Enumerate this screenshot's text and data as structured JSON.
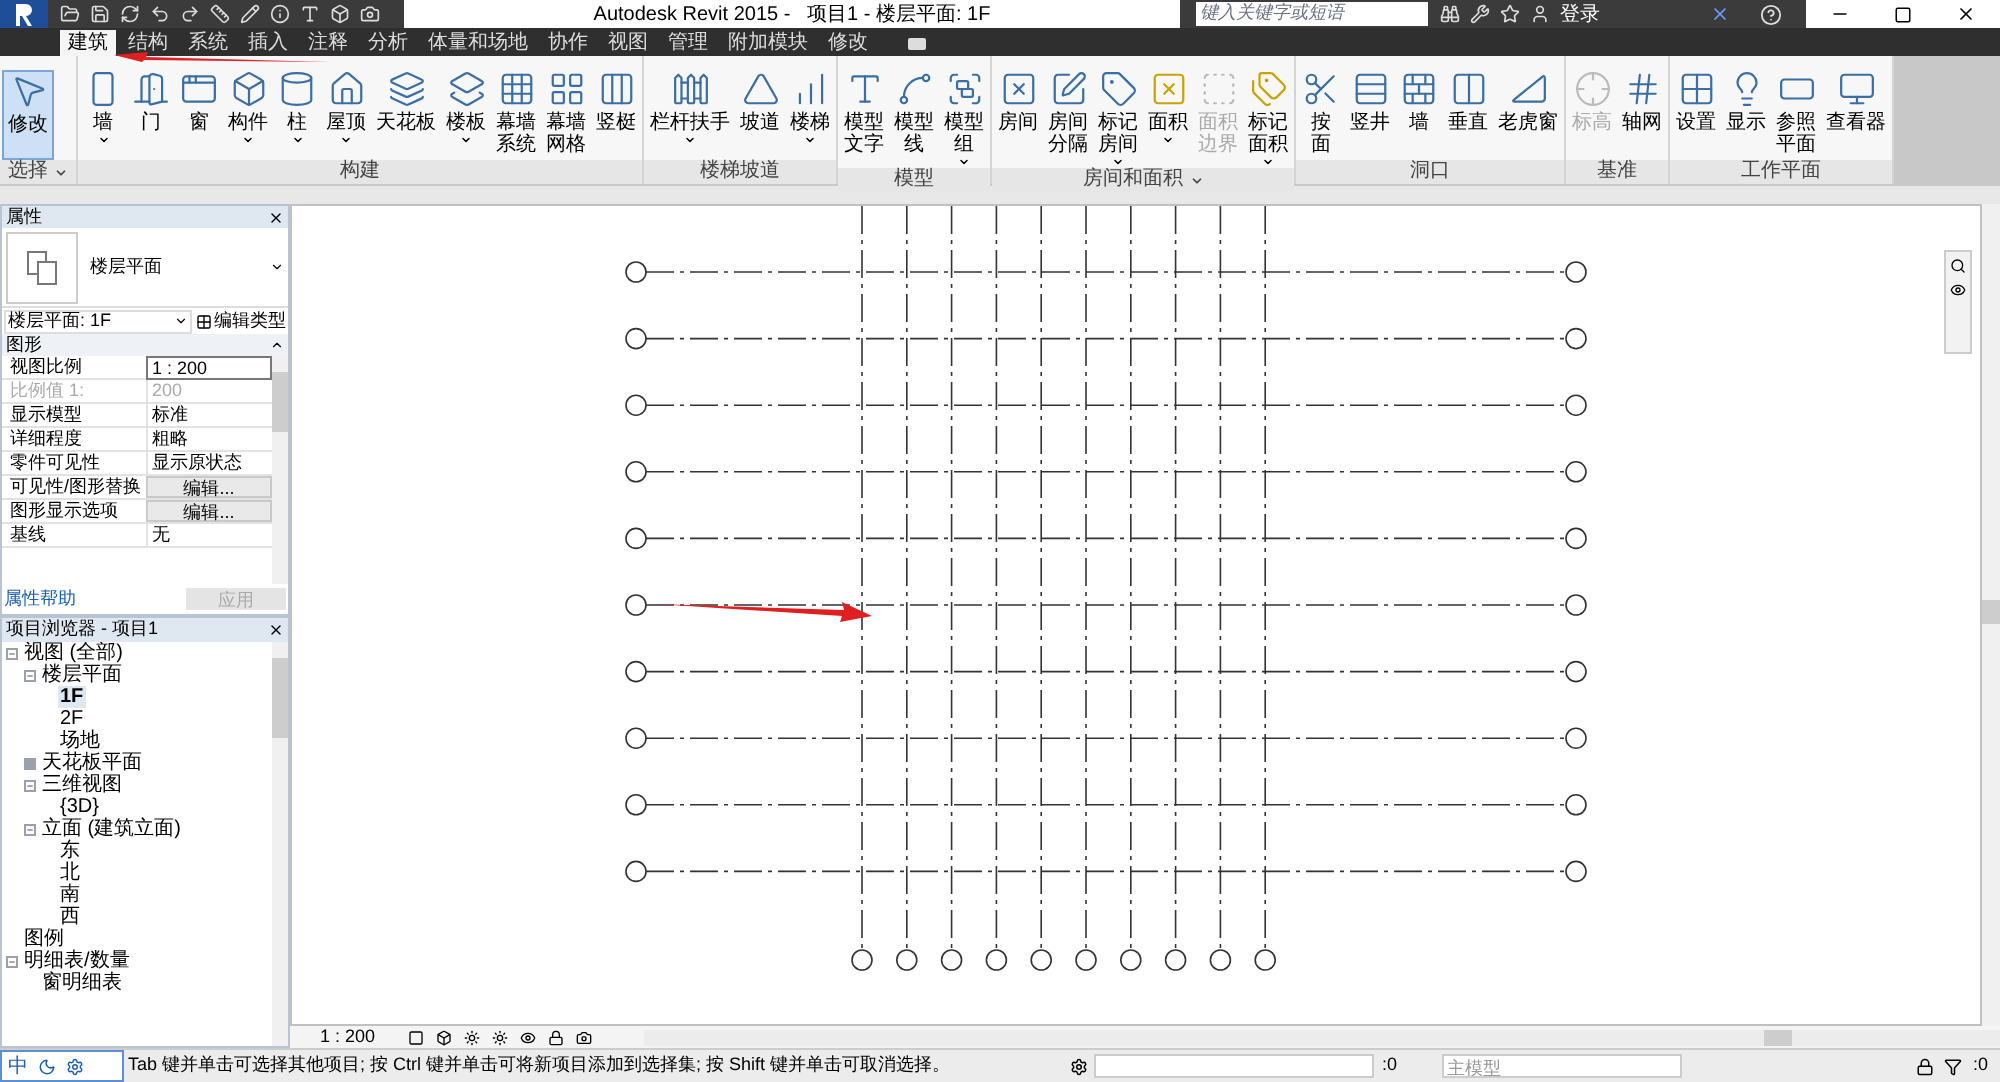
{
  "window": {
    "title": "Autodesk Revit 2015 -   项目1 - 楼层平面: 1F",
    "search": {
      "placeholder": "键入关键字或短语"
    },
    "login": "登录"
  },
  "tabs": [
    {
      "label": "建筑",
      "selected": true
    },
    {
      "label": "结构",
      "selected": false
    },
    {
      "label": "系统",
      "selected": false
    },
    {
      "label": "插入",
      "selected": false
    },
    {
      "label": "注释",
      "selected": false
    },
    {
      "label": "分析",
      "selected": false
    },
    {
      "label": "体量和场地",
      "selected": false
    },
    {
      "label": "协作",
      "selected": false
    },
    {
      "label": "视图",
      "selected": false
    },
    {
      "label": "管理",
      "selected": false
    },
    {
      "label": "附加模块",
      "selected": false
    },
    {
      "label": "修改",
      "selected": false
    }
  ],
  "ribbon": [
    {
      "label": "选择",
      "has_menu": true,
      "tools": [
        {
          "lines": [
            "修改"
          ],
          "selected": true,
          "disabled": false,
          "has_menu": false
        }
      ]
    },
    {
      "label": "构建",
      "has_menu": false,
      "tools": [
        {
          "lines": [
            "墙"
          ],
          "selected": false,
          "disabled": false,
          "has_menu": true
        },
        {
          "lines": [
            "门"
          ],
          "selected": false,
          "disabled": false,
          "has_menu": false
        },
        {
          "lines": [
            "窗"
          ],
          "selected": false,
          "disabled": false,
          "has_menu": false
        },
        {
          "lines": [
            "构件"
          ],
          "selected": false,
          "disabled": false,
          "has_menu": true
        },
        {
          "lines": [
            "柱"
          ],
          "selected": false,
          "disabled": false,
          "has_menu": true
        },
        {
          "lines": [
            "屋顶"
          ],
          "selected": false,
          "disabled": false,
          "has_menu": true
        },
        {
          "lines": [
            "天花板"
          ],
          "selected": false,
          "disabled": false,
          "has_menu": false
        },
        {
          "lines": [
            "楼板"
          ],
          "selected": false,
          "disabled": false,
          "has_menu": true
        },
        {
          "lines": [
            "幕墙",
            "系统"
          ],
          "selected": false,
          "disabled": false,
          "has_menu": false
        },
        {
          "lines": [
            "幕墙",
            "网格"
          ],
          "selected": false,
          "disabled": false,
          "has_menu": false
        },
        {
          "lines": [
            "竖梃"
          ],
          "selected": false,
          "disabled": false,
          "has_menu": false
        }
      ]
    },
    {
      "label": "楼梯坡道",
      "has_menu": false,
      "tools": [
        {
          "lines": [
            "栏杆扶手"
          ],
          "selected": false,
          "disabled": false,
          "has_menu": true
        },
        {
          "lines": [
            "坡道"
          ],
          "selected": false,
          "disabled": false,
          "has_menu": false
        },
        {
          "lines": [
            "楼梯"
          ],
          "selected": false,
          "disabled": false,
          "has_menu": true
        }
      ]
    },
    {
      "label": "模型",
      "has_menu": false,
      "tools": [
        {
          "lines": [
            "模型",
            "文字"
          ],
          "selected": false,
          "disabled": false,
          "has_menu": false
        },
        {
          "lines": [
            "模型",
            "线"
          ],
          "selected": false,
          "disabled": false,
          "has_menu": false
        },
        {
          "lines": [
            "模型",
            "组"
          ],
          "selected": false,
          "disabled": false,
          "has_menu": true
        }
      ]
    },
    {
      "label": "房间和面积",
      "has_menu": true,
      "tools": [
        {
          "lines": [
            "房间"
          ],
          "selected": false,
          "disabled": false,
          "has_menu": false
        },
        {
          "lines": [
            "房间",
            "分隔"
          ],
          "selected": false,
          "disabled": false,
          "has_menu": false
        },
        {
          "lines": [
            "标记",
            "房间"
          ],
          "selected": false,
          "disabled": false,
          "has_menu": true
        },
        {
          "lines": [
            "面积"
          ],
          "selected": false,
          "disabled": false,
          "has_menu": true
        },
        {
          "lines": [
            "面积",
            "边界"
          ],
          "selected": false,
          "disabled": true,
          "has_menu": false
        },
        {
          "lines": [
            "标记",
            "面积"
          ],
          "selected": false,
          "disabled": false,
          "has_menu": true
        }
      ]
    },
    {
      "label": "洞口",
      "has_menu": false,
      "tools": [
        {
          "lines": [
            "按",
            "面"
          ],
          "selected": false,
          "disabled": false,
          "has_menu": false
        },
        {
          "lines": [
            "竖井"
          ],
          "selected": false,
          "disabled": false,
          "has_menu": false
        },
        {
          "lines": [
            "墙"
          ],
          "selected": false,
          "disabled": false,
          "has_menu": false
        },
        {
          "lines": [
            "垂直"
          ],
          "selected": false,
          "disabled": false,
          "has_menu": false
        },
        {
          "lines": [
            "老虎窗"
          ],
          "selected": false,
          "disabled": false,
          "has_menu": false
        }
      ]
    },
    {
      "label": "基准",
      "has_menu": false,
      "tools": [
        {
          "lines": [
            "标高"
          ],
          "selected": false,
          "disabled": true,
          "has_menu": false
        },
        {
          "lines": [
            "轴网"
          ],
          "selected": false,
          "disabled": false,
          "has_menu": false
        }
      ]
    },
    {
      "label": "工作平面",
      "has_menu": false,
      "tools": [
        {
          "lines": [
            "设置"
          ],
          "selected": false,
          "disabled": false,
          "has_menu": false
        },
        {
          "lines": [
            "显示"
          ],
          "selected": false,
          "disabled": false,
          "has_menu": false
        },
        {
          "lines": [
            "参照",
            "平面"
          ],
          "selected": false,
          "disabled": false,
          "has_menu": false
        },
        {
          "lines": [
            "查看器"
          ],
          "selected": false,
          "disabled": false,
          "has_menu": false
        }
      ]
    }
  ],
  "properties": {
    "title": "属性",
    "type_name": "楼层平面",
    "instance": "楼层平面: 1F",
    "edit_type": "编辑类型",
    "section": "图形",
    "rows": [
      {
        "name": "视图比例",
        "value": "1 : 200",
        "kind": "field",
        "disabled": false
      },
      {
        "name": "比例值 1:",
        "value": "200",
        "kind": "text",
        "disabled": true
      },
      {
        "name": "显示模型",
        "value": "标准",
        "kind": "text",
        "disabled": false
      },
      {
        "name": "详细程度",
        "value": "粗略",
        "kind": "text",
        "disabled": false
      },
      {
        "name": "零件可见性",
        "value": "显示原状态",
        "kind": "text",
        "disabled": false
      },
      {
        "name": "可见性/图形替换",
        "value": "编辑...",
        "kind": "button",
        "disabled": false
      },
      {
        "name": "图形显示选项",
        "value": "编辑...",
        "kind": "button",
        "disabled": false
      },
      {
        "name": "基线",
        "value": "无",
        "kind": "text",
        "disabled": false
      }
    ],
    "help_link": "属性帮助",
    "apply": {
      "label": "应用",
      "disabled": true
    }
  },
  "browser": {
    "title": "项目浏览器 - 项目1",
    "tree": [
      {
        "label": "视图 (全部)",
        "selected": false,
        "expanded": true,
        "children": [
          {
            "label": "楼层平面",
            "selected": false,
            "expanded": true,
            "children": [
              {
                "label": "1F",
                "selected": true
              },
              {
                "label": "2F",
                "selected": false
              },
              {
                "label": "场地",
                "selected": false
              }
            ]
          },
          {
            "label": "天花板平面",
            "selected": false,
            "expanded": false
          },
          {
            "label": "三维视图",
            "selected": false,
            "expanded": true,
            "children": [
              {
                "label": "{3D}",
                "selected": false
              }
            ]
          },
          {
            "label": "立面 (建筑立面)",
            "selected": false,
            "expanded": true,
            "children": [
              {
                "label": "东",
                "selected": false
              },
              {
                "label": "北",
                "selected": false
              },
              {
                "label": "南",
                "selected": false
              },
              {
                "label": "西",
                "selected": false
              }
            ]
          }
        ]
      },
      {
        "label": "图例",
        "selected": false
      },
      {
        "label": "明细表/数量",
        "selected": false,
        "expanded": true,
        "children": [
          {
            "label": "窗明细表",
            "selected": false
          }
        ]
      }
    ]
  },
  "ime": {
    "label": "中"
  },
  "view_bar": {
    "scale": "1 : 200"
  },
  "status_bar": {
    "message": "Tab 键并单击可选择其他项目; 按 Ctrl 键并单击可将新项目添加到选择集; 按 Shift 键并单击可取消选择。",
    "count_1": ":0",
    "model": "主模型",
    "count_2": ":0"
  }
}
